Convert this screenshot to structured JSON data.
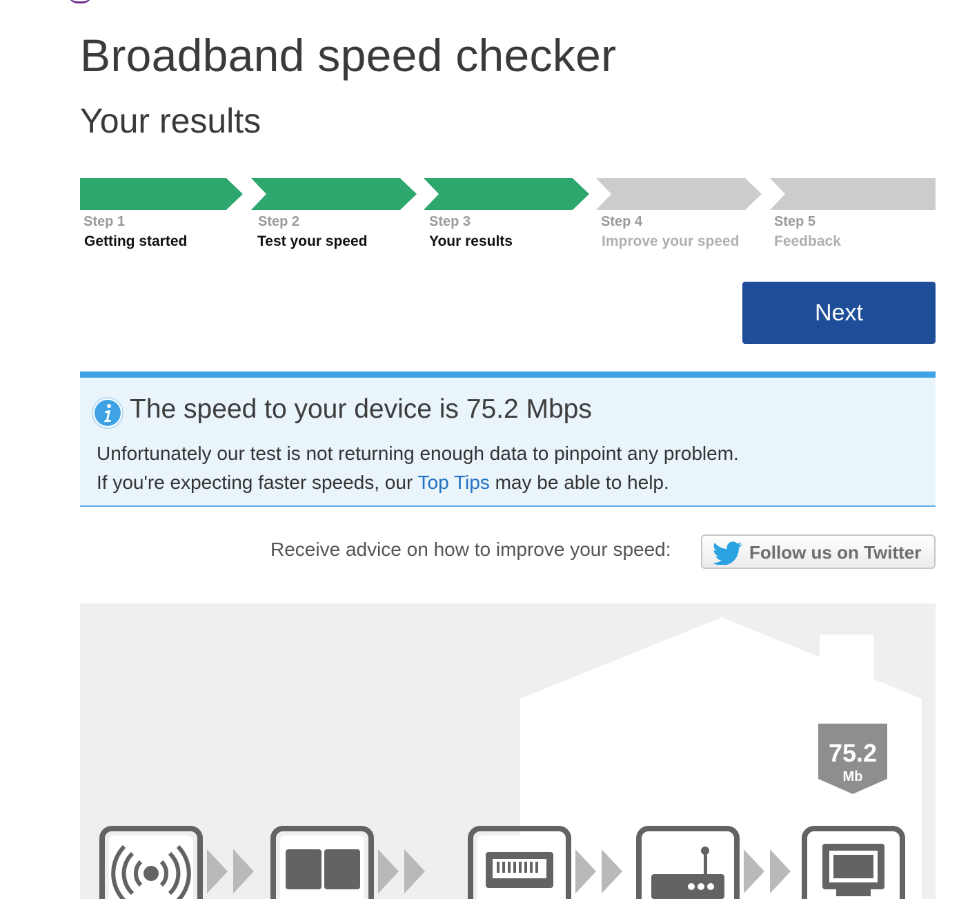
{
  "header": {
    "title": "Broadband speed checker",
    "subtitle": "Your results"
  },
  "steps": [
    {
      "number": "Step 1",
      "label": "Getting started",
      "state": "complete"
    },
    {
      "number": "Step 2",
      "label": "Test your speed",
      "state": "complete"
    },
    {
      "number": "Step 3",
      "label": "Your results",
      "state": "current"
    },
    {
      "number": "Step 4",
      "label": "Improve your speed",
      "state": "upcoming"
    },
    {
      "number": "Step 5",
      "label": "Feedback",
      "state": "upcoming"
    }
  ],
  "actions": {
    "next_label": "Next"
  },
  "result": {
    "icon": "info-icon",
    "heading": "The speed to your device is 75.2 Mbps",
    "line1": "Unfortunately our test is not returning enough data to pinpoint any problem.",
    "line2_before": "If you're expecting faster speeds, our ",
    "line2_link": "Top Tips",
    "line2_after": " may be able to help."
  },
  "advice": {
    "text": "Receive advice on how to improve your speed:",
    "twitter_label": "Follow us on Twitter",
    "twitter_icon": "twitter-bird-icon"
  },
  "diagram": {
    "speed_value": "75.2",
    "speed_unit": "Mb",
    "devices": [
      "wireless-signal-icon",
      "cabinet-icon",
      "phone-socket-icon",
      "router-icon",
      "computer-icon"
    ]
  },
  "colors": {
    "step_complete": "#2ea76f",
    "step_upcoming": "#cccccc",
    "primary_button": "#1f4e99",
    "info_border": "#3ea2e5",
    "info_background": "#eaf4fb",
    "link": "#2272c3"
  }
}
